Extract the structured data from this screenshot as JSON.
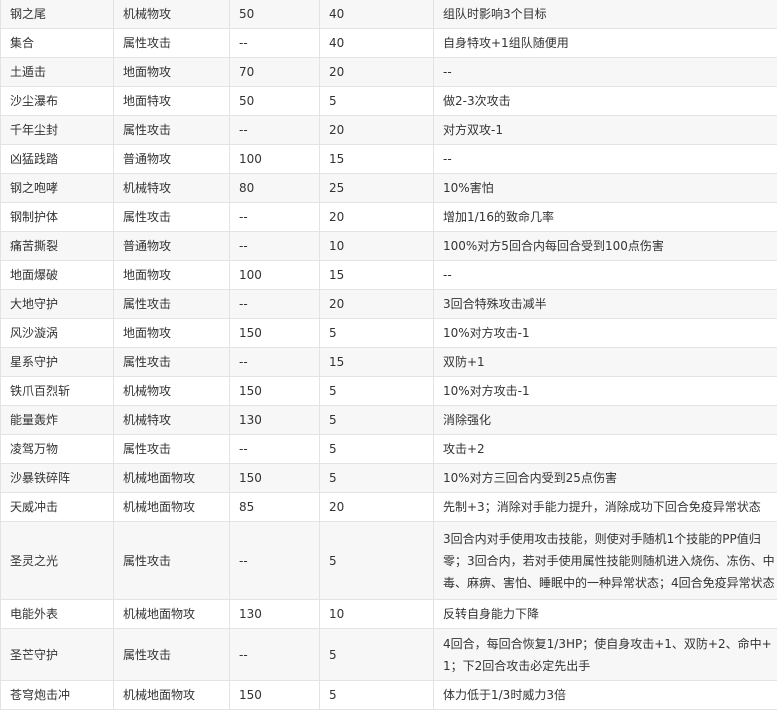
{
  "rows": [
    {
      "name": "钢之尾",
      "type": "机械物攻",
      "power": "50",
      "pp": "40",
      "effect": "组队时影响3个目标"
    },
    {
      "name": "集合",
      "type": "属性攻击",
      "power": "--",
      "pp": "40",
      "effect": "自身特攻+1组队随便用"
    },
    {
      "name": "土遁击",
      "type": "地面物攻",
      "power": "70",
      "pp": "20",
      "effect": "--"
    },
    {
      "name": "沙尘瀑布",
      "type": "地面特攻",
      "power": "50",
      "pp": "5",
      "effect": "做2-3次攻击"
    },
    {
      "name": "千年尘封",
      "type": "属性攻击",
      "power": "--",
      "pp": "20",
      "effect": "对方双攻-1"
    },
    {
      "name": "凶猛践踏",
      "type": "普通物攻",
      "power": "100",
      "pp": "15",
      "effect": "--"
    },
    {
      "name": "钢之咆哮",
      "type": "机械特攻",
      "power": "80",
      "pp": "25",
      "effect": "10%害怕"
    },
    {
      "name": "钢制护体",
      "type": "属性攻击",
      "power": "--",
      "pp": "20",
      "effect": "增加1/16的致命几率"
    },
    {
      "name": "痛苦撕裂",
      "type": "普通物攻",
      "power": "--",
      "pp": "10",
      "effect": "100%对方5回合内每回合受到100点伤害"
    },
    {
      "name": "地面爆破",
      "type": "地面物攻",
      "power": "100",
      "pp": "15",
      "effect": "--"
    },
    {
      "name": "大地守护",
      "type": "属性攻击",
      "power": "--",
      "pp": "20",
      "effect": "3回合特殊攻击减半"
    },
    {
      "name": "风沙漩涡",
      "type": "地面物攻",
      "power": "150",
      "pp": "5",
      "effect": "10%对方攻击-1"
    },
    {
      "name": "星系守护",
      "type": "属性攻击",
      "power": "--",
      "pp": "15",
      "effect": "双防+1"
    },
    {
      "name": "铁爪百烈斩",
      "type": "机械物攻",
      "power": "150",
      "pp": "5",
      "effect": "10%对方攻击-1"
    },
    {
      "name": "能量轰炸",
      "type": "机械特攻",
      "power": "130",
      "pp": "5",
      "effect": "消除强化"
    },
    {
      "name": "凌驾万物",
      "type": "属性攻击",
      "power": "--",
      "pp": "5",
      "effect": "攻击+2"
    },
    {
      "name": "沙暴铁碎阵",
      "type": "机械地面物攻",
      "power": "150",
      "pp": "5",
      "effect": "10%对方三回合内受到25点伤害"
    },
    {
      "name": "天威冲击",
      "type": "机械地面物攻",
      "power": "85",
      "pp": "20",
      "effect": "先制+3；消除对手能力提升，消除成功下回合免疫异常状态"
    },
    {
      "name": "圣灵之光",
      "type": "属性攻击",
      "power": "--",
      "pp": "5",
      "effect": "3回合内对手使用攻击技能，则使对手随机1个技能的PP值归零；3回合内，若对手使用属性技能则随机进入烧伤、冻伤、中毒、麻痹、害怕、睡眠中的一种异常状态；4回合免疫异常状态"
    },
    {
      "name": "电能外表",
      "type": "机械地面物攻",
      "power": "130",
      "pp": "10",
      "effect": "反转自身能力下降"
    },
    {
      "name": "圣芒守护",
      "type": "属性攻击",
      "power": "--",
      "pp": "5",
      "effect": "4回合，每回合恢复1/3HP；使自身攻击+1、双防+2、命中+1；下2回合攻击必定先出手"
    },
    {
      "name": "苍穹炮击冲",
      "type": "机械地面物攻",
      "power": "150",
      "pp": "5",
      "effect": "体力低于1/3时威力3倍"
    }
  ]
}
